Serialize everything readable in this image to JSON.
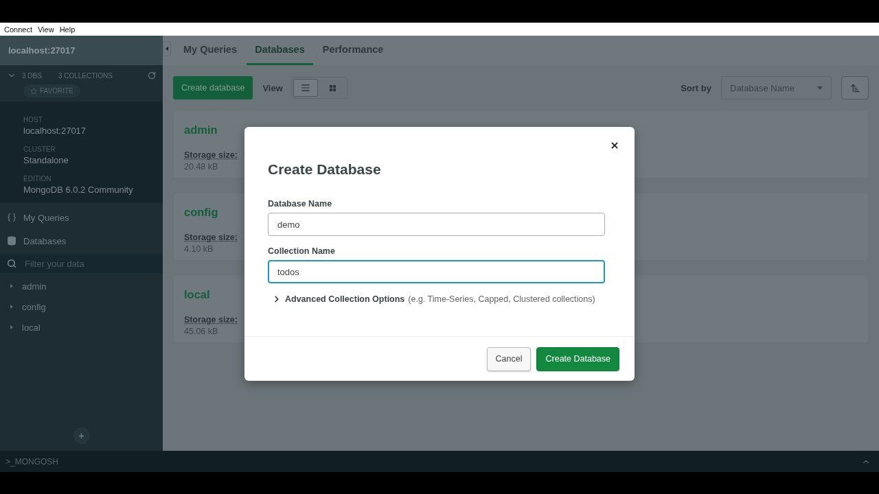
{
  "menu": [
    {
      "label": "Connect"
    },
    {
      "label": "View"
    },
    {
      "label": "Help"
    }
  ],
  "sidebar": {
    "connection": "localhost:27017",
    "expanded": true,
    "stats": [
      {
        "count": "3",
        "label": "DBS"
      },
      {
        "count": "3",
        "label": "COLLECTIONS"
      }
    ],
    "favorite": "FAVORITE",
    "info": [
      {
        "label": "HOST",
        "value": "localhost:27017"
      },
      {
        "label": "CLUSTER",
        "value": "Standalone"
      },
      {
        "label": "EDITION",
        "value": "MongoDB 6.0.2 Community"
      }
    ],
    "nav": [
      {
        "label": "My Queries",
        "kind": "queries"
      },
      {
        "label": "Databases",
        "kind": "databases"
      }
    ],
    "filter": {
      "placeholder": "Filter your data"
    },
    "databases": [
      {
        "name": "admin",
        "expanded": false
      },
      {
        "name": "config",
        "expanded": false
      },
      {
        "name": "local",
        "expanded": false
      }
    ]
  },
  "tabs": [
    {
      "label": "My Queries",
      "selected": false
    },
    {
      "label": "Databases",
      "selected": true
    },
    {
      "label": "Performance",
      "selected": false
    }
  ],
  "toolbar": {
    "create_button": "Create database",
    "view_label": "View",
    "views": [
      {
        "kind": "list",
        "selected": true
      },
      {
        "kind": "grid",
        "selected": false
      }
    ],
    "sort_label": "Sort by",
    "sort_value": "Database Name"
  },
  "databases": [
    {
      "name": "admin",
      "storage_label": "Storage size:",
      "storage_value": "20.48 kB"
    },
    {
      "name": "config",
      "storage_label": "Storage size:",
      "storage_value": "4.10 kB"
    },
    {
      "name": "local",
      "storage_label": "Storage size:",
      "storage_value": "45.06 kB"
    }
  ],
  "dialog": {
    "title": "Create Database",
    "fields": [
      {
        "label": "Database Name",
        "value": "demo",
        "focused": false
      },
      {
        "label": "Collection Name",
        "value": "todos",
        "focused": true
      }
    ],
    "advanced": {
      "label": "Advanced Collection Options",
      "hint": "(e.g. Time-Series, Capped, Clustered collections)",
      "expanded": false
    },
    "buttons": [
      {
        "label": "Cancel",
        "kind": "secondary"
      },
      {
        "label": "Create Database",
        "kind": "primary"
      }
    ]
  },
  "shell": {
    "label": ">_MONGOSH"
  }
}
